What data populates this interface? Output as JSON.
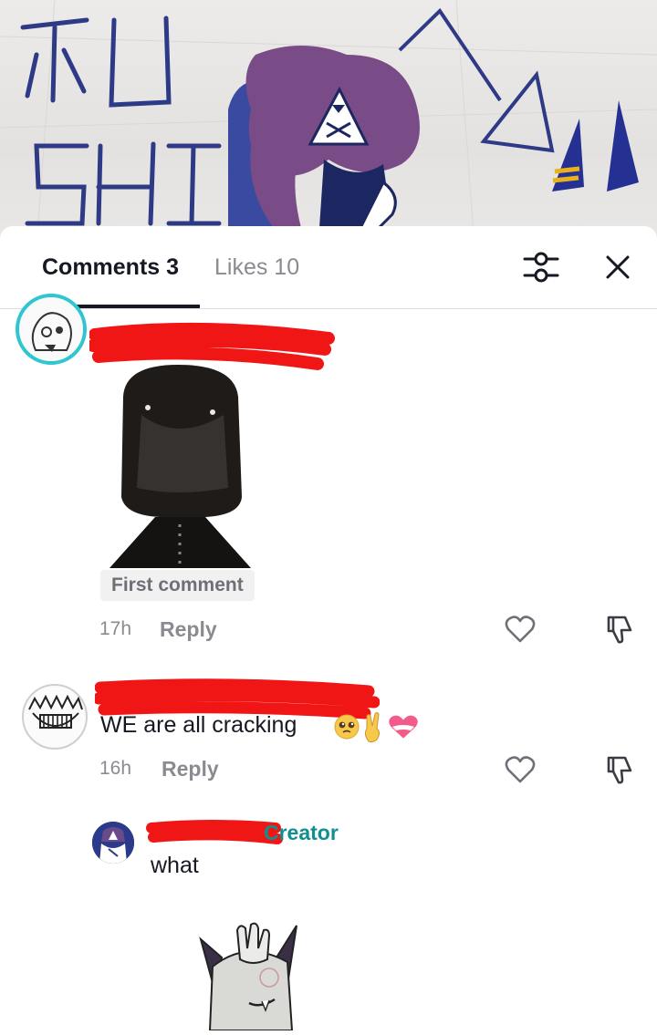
{
  "artwork": {
    "text_line_1": "KU",
    "text_line_2": "SHI"
  },
  "header": {
    "tab_comments": "Comments 3",
    "tab_likes": "Likes 10",
    "filter_icon": "sliders-icon",
    "close_icon": "close-icon"
  },
  "comments": [
    {
      "tag": "First comment",
      "time": "17h",
      "reply_label": "Reply"
    },
    {
      "text": "WE are all cracking",
      "time": "16h",
      "reply_label": "Reply",
      "emojis": [
        "pleading-face",
        "victory-hand",
        "heart"
      ]
    },
    {
      "badge": "Creator",
      "text": "what"
    }
  ],
  "colors": {
    "accent_teal": "#2fc6cf",
    "creator_badge": "#0f8f8f",
    "redaction": "#f01616",
    "muted_text": "#8a8b91"
  }
}
